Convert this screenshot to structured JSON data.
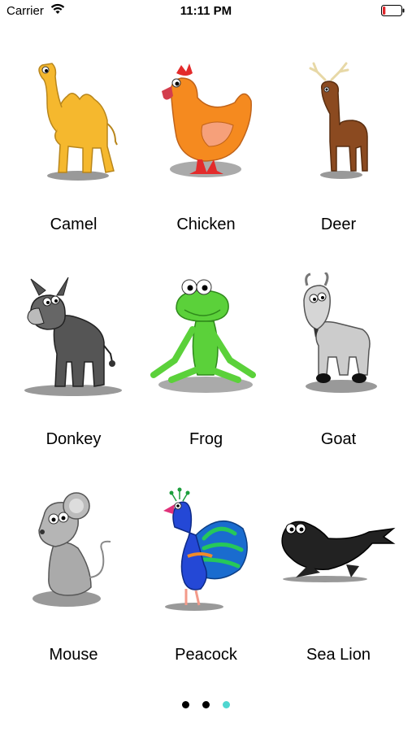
{
  "status_bar": {
    "carrier": "Carrier",
    "time": "11:11 PM",
    "battery_level": 0.15,
    "battery_color": "#e0272b"
  },
  "animals": [
    {
      "label": "Camel",
      "icon": "camel-icon"
    },
    {
      "label": "Chicken",
      "icon": "chicken-icon"
    },
    {
      "label": "Deer",
      "icon": "deer-icon"
    },
    {
      "label": "Donkey",
      "icon": "donkey-icon"
    },
    {
      "label": "Frog",
      "icon": "frog-icon"
    },
    {
      "label": "Goat",
      "icon": "goat-icon"
    },
    {
      "label": "Mouse",
      "icon": "mouse-icon"
    },
    {
      "label": "Peacock",
      "icon": "peacock-icon"
    },
    {
      "label": "Sea Lion",
      "icon": "sea-lion-icon"
    }
  ],
  "pager": {
    "page_count": 3,
    "current_page": 3,
    "active_color": "#4fd6d0",
    "inactive_color": "#000000"
  }
}
